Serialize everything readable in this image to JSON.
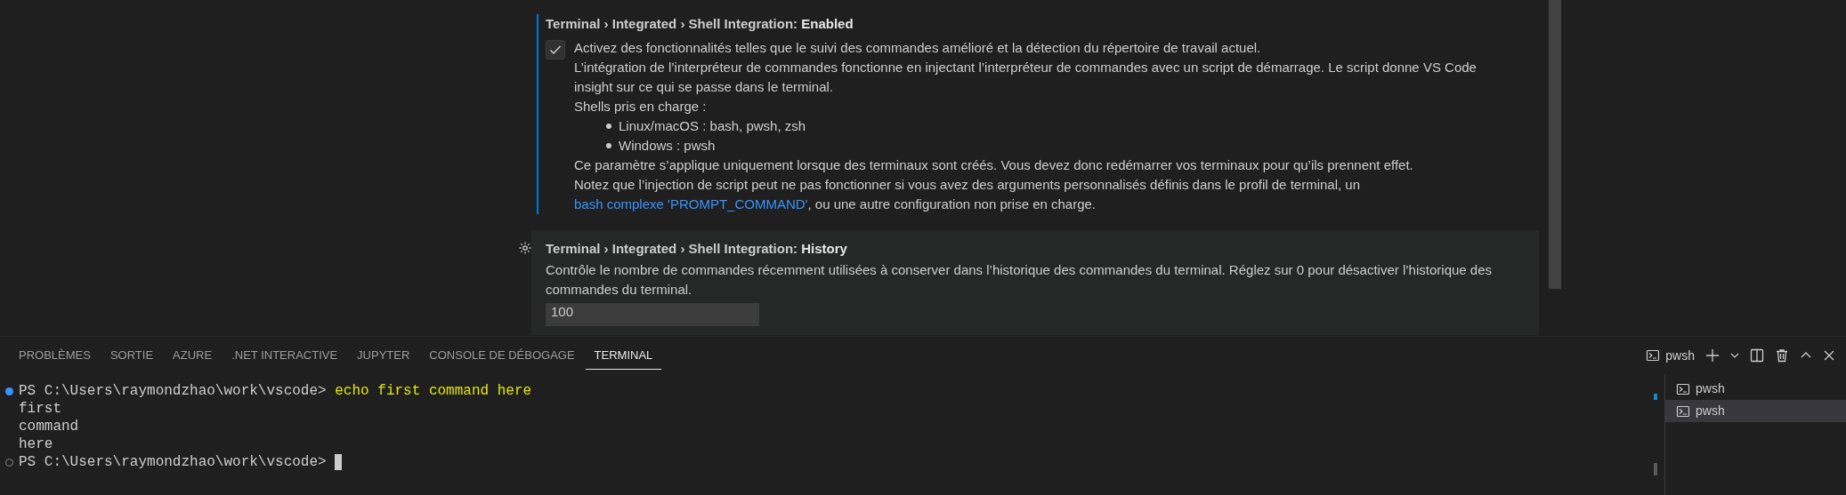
{
  "settings": [
    {
      "breadcrumb": "Terminal › Integrated › Shell Integration: ",
      "name": "Enabled",
      "kind": "checkbox",
      "checked": true,
      "focused": true,
      "hovered": false,
      "description": [
        {
          "kind": "text",
          "text": "Activez des fonctionnalités telles que le suivi des commandes amélioré et la détection du répertoire de travail actuel."
        },
        {
          "kind": "text",
          "text": "L’intégration de l’interpréteur de commandes fonctionne en injectant l’interpréteur de commandes avec un script de démarrage. Le script donne VS Code insight sur ce qui se passe dans le terminal."
        },
        {
          "kind": "text",
          "text": "Shells pris en charge :"
        },
        {
          "kind": "list",
          "items": [
            "Linux/macOS : bash, pwsh, zsh",
            "Windows : pwsh"
          ]
        },
        {
          "kind": "text",
          "text": "Ce paramètre s’applique uniquement lorsque des terminaux sont créés. Vous devez donc redémarrer vos terminaux pour qu’ils prennent effet."
        },
        {
          "kind": "link",
          "before": "Notez que l’injection de script peut ne pas fonctionner si vous avez des arguments personnalisés définis dans le profil de terminal, un ",
          "link": "bash complexe 'PROMPT_COMMAND'",
          "after": ", ou une autre configuration non prise en charge."
        }
      ]
    },
    {
      "breadcrumb": "Terminal › Integrated › Shell Integration: ",
      "name": "History",
      "kind": "number",
      "value": "100",
      "focused": false,
      "hovered": true,
      "description": [
        {
          "kind": "text",
          "text": "Contrôle le nombre de commandes récemment utilisées à conserver dans l’historique des commandes du terminal. Réglez sur 0 pour désactiver l’historique des commandes du terminal."
        }
      ]
    }
  ],
  "panel_tabs": [
    {
      "label": "PROBLÈMES",
      "selected": false
    },
    {
      "label": "SORTIE",
      "selected": false
    },
    {
      "label": "AZURE",
      "selected": false
    },
    {
      "label": ".NET INTERACTIVE",
      "selected": false
    },
    {
      "label": "JUPYTER",
      "selected": false
    },
    {
      "label": "CONSOLE DE DÉBOGAGE",
      "selected": false
    },
    {
      "label": "TERMINAL",
      "selected": true
    }
  ],
  "terminal_toolbar": {
    "active_terminal": "pwsh"
  },
  "terminal_lines": [
    {
      "kind": "prompt",
      "succeeded": true,
      "cursor": false,
      "prompt": "PS C:\\Users\\raymondzhao\\work\\vscode> ",
      "command": "echo first command here"
    },
    {
      "kind": "output",
      "text": "first"
    },
    {
      "kind": "output",
      "text": "command"
    },
    {
      "kind": "output",
      "text": "here"
    },
    {
      "kind": "prompt",
      "succeeded": false,
      "cursor": true,
      "prompt": "PS C:\\Users\\raymondzhao\\work\\vscode> "
    }
  ],
  "terminals": [
    {
      "label": "pwsh",
      "selected": false
    },
    {
      "label": "pwsh",
      "selected": true
    }
  ]
}
